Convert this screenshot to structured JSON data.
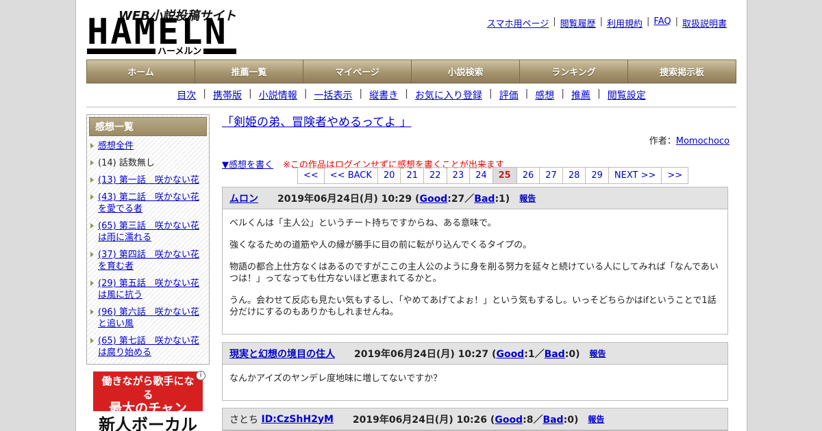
{
  "logo": {
    "sub": "WEB小説投稿サイト",
    "main": "HAMELN",
    "kana": "ハーメルン"
  },
  "toplinks": [
    "スマホ用ページ",
    "閲覧履歴",
    "利用規約",
    "FAQ",
    "取扱説明書"
  ],
  "mainnav": [
    "ホーム",
    "推薦一覧",
    "マイページ",
    "小説検索",
    "ランキング",
    "捜索掲示板"
  ],
  "subnav": [
    "目次",
    "携帯版",
    "小説情報",
    "一括表示",
    "縦書き",
    "お気に入り登録",
    "評価",
    "感想",
    "推薦",
    "閲覧設定"
  ],
  "sidebar": {
    "head": "感想一覧",
    "items": [
      {
        "label": "感想全件",
        "link": true
      },
      {
        "label": "(14) 話数無し",
        "link": false
      },
      {
        "label": "(13) 第一話　咲かない花",
        "link": true
      },
      {
        "label": "(43) 第二話　咲かない花を愛でる者",
        "link": true
      },
      {
        "label": "(65) 第三話　咲かない花は雨に濡れる",
        "link": true
      },
      {
        "label": "(37) 第四話　咲かない花を育む者",
        "link": true
      },
      {
        "label": "(29) 第五話　咲かない花は風に抗う",
        "link": true
      },
      {
        "label": "(96) 第六話　咲かない花と追い風",
        "link": true
      },
      {
        "label": "(65) 第七話　咲かない花は腐り始める",
        "link": true
      }
    ]
  },
  "ad": {
    "line1": "働きながら歌手になる",
    "line2": "最大のチャンス!!",
    "line3": "新人ボーカル",
    "info": "i"
  },
  "content": {
    "title": "「剣姫の弟、冒険者やめるってよ 」",
    "author_label": "作者：",
    "author": "Momochoco",
    "write_link": "▼感想を書く",
    "warning": "※この作品はログインせずに感想を書くことが出来ます"
  },
  "pager": [
    "<<",
    "<< BACK",
    "20",
    "21",
    "22",
    "23",
    "24",
    "25",
    "26",
    "27",
    "28",
    "29",
    "NEXT >>",
    ">>"
  ],
  "pager_current": "25",
  "comments": [
    {
      "name": "ムロン",
      "name_link": true,
      "id": "",
      "date": "2019年06月24日(月) 10:29",
      "good": "27",
      "bad": "1",
      "report": "報告",
      "body": [
        "ベルくんは「主人公」というチート持ちですからね、ある意味で。",
        "強くなるための道筋や人の縁が勝手に目の前に転がり込んでくるタイプの。",
        "物語の都合上仕方なくはあるのですがここの主人公のように身を削る努力を延々と続けている人にしてみれば「なんであいつは！」ってなっても仕方ないほど恵まれてるかと。",
        "うん。会わせて反応も見たい気もするし、「やめてあげてよぉ！」という気もするし。いっそどちらかはifということで1話分だけにするのもありかもしれませんね。"
      ]
    },
    {
      "name": "現実と幻想の境目の住人",
      "name_link": true,
      "id": "",
      "date": "2019年06月24日(月) 10:27",
      "good": "1",
      "bad": "0",
      "report": "報告",
      "body": [
        "なんかアイズのヤンデレ度地味に増してないですか？"
      ]
    },
    {
      "name": "さとち",
      "name_link": false,
      "id": "ID:CzShH2yM",
      "date": "2019年06月24日(月) 10:26",
      "good": "8",
      "bad": "0",
      "report": "報告",
      "body": []
    }
  ],
  "labels": {
    "good": "Good",
    "bad": "Bad"
  }
}
